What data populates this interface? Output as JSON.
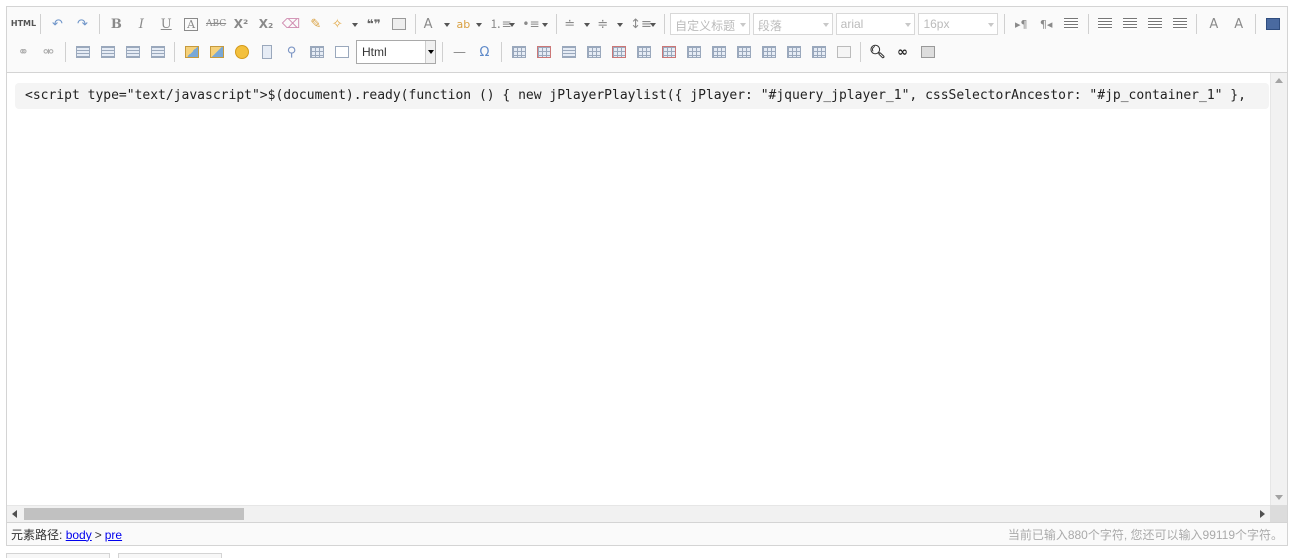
{
  "toolbar": {
    "html_mode_label": "HTML",
    "bold_label": "B",
    "italic_label": "I",
    "underline_label": "U",
    "font_border_label": "A",
    "strikethrough_label": "ABC",
    "superscript_label": "X²",
    "subscript_label": "X₂",
    "blockquote_label": "❝❞",
    "fontcolor_label": "A",
    "custom_heading_placeholder": "自定义标题",
    "paragraph_placeholder": "段落",
    "font_family_value": "arial",
    "font_size_value": "16px",
    "code_language_value": "Html",
    "horizontal_rule_label": "—",
    "special_char_label": "Ω",
    "fontsize_a_label": "A",
    "fontsize_a2_label": "A"
  },
  "content": {
    "code_text": "<script type=\"text/javascript\">$(document).ready(function () { new jPlayerPlaylist({ jPlayer: \"#jquery_jplayer_1\", cssSelectorAncestor: \"#jp_container_1\" },"
  },
  "statusbar": {
    "path_label": "元素路径:",
    "path_items": [
      "body",
      "pre"
    ],
    "path_separator": ">",
    "word_count": "当前已输入880个字符, 您还可以输入99119个字符。"
  },
  "colors": {
    "icon_gray": "#8a8a8a",
    "link_blue": "#0000ee",
    "toolbar_bg": "#fafafa",
    "border": "#d4d4d4"
  }
}
